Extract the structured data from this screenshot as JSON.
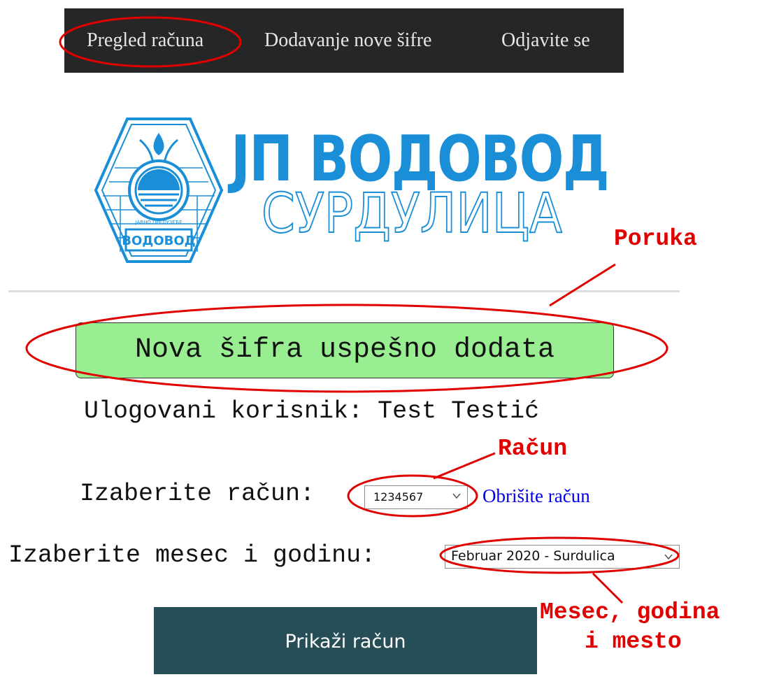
{
  "nav": {
    "items": [
      {
        "label": "Pregled računa"
      },
      {
        "label": "Dodavanje nove šifre"
      },
      {
        "label": "Odjavite se"
      }
    ]
  },
  "logo": {
    "title": "ЈП ВОДОВОД",
    "subtitle": "СУРДУЛИЦА",
    "badge_text": "ВОДОВОД",
    "ring_text": "ЈАВНО ПРЕДУЗЕЋЕ"
  },
  "message": {
    "text": "Nova šifra uspešno dodata",
    "bg_color": "#98ee90"
  },
  "user": {
    "line": "Ulogovani korisnik: Test Testić"
  },
  "account": {
    "label": "Izaberite račun:",
    "selected": "1234567",
    "delete_link": "Obrišite račun"
  },
  "period": {
    "label": "Izaberite mesec i godinu:",
    "selected": "Februar 2020 - Surdulica"
  },
  "show_button": {
    "label": "Prikaži račun",
    "bg_color": "#264e57"
  },
  "annotations": {
    "color": "#e00000",
    "poruka": "Poruka",
    "racun": "Račun",
    "mesec_line1": "Mesec, godina",
    "mesec_line2": "i mesto"
  },
  "colors": {
    "navbar_bg": "#262626",
    "logo_blue": "#1a8fd8",
    "link": "#0000ee"
  }
}
